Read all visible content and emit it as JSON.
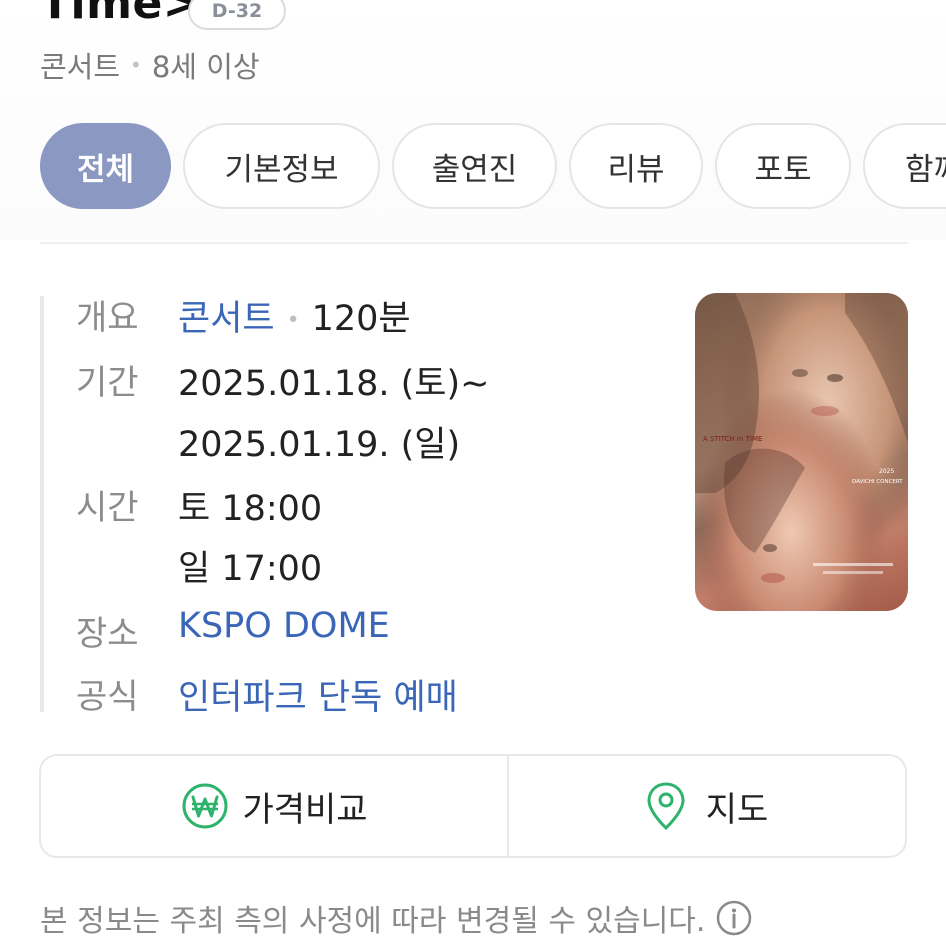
{
  "header": {
    "title": "Time>",
    "dday": "D-32",
    "category": "콘서트",
    "age": "8세 이상"
  },
  "tabs": [
    {
      "label": "전체",
      "active": true
    },
    {
      "label": "기본정보"
    },
    {
      "label": "출연진"
    },
    {
      "label": "리뷰"
    },
    {
      "label": "포토"
    },
    {
      "label": "함께"
    }
  ],
  "info": {
    "overview": {
      "label": "개요",
      "genre": "콘서트",
      "runtime": "120분"
    },
    "period": {
      "label": "기간",
      "start": "2025.01.18. (토)~",
      "end": "2025.01.19. (일)"
    },
    "time": {
      "label": "시간",
      "line1": "토 18:00",
      "line2": "일 17:00"
    },
    "venue": {
      "label": "장소",
      "value": "KSPO DOME"
    },
    "official": {
      "label": "공식",
      "value": "인터파크 단독 예매"
    }
  },
  "poster": {
    "text_1": "A STITCH in TIME",
    "text_2": "2025",
    "text_3": "DAVICHI CONCERT"
  },
  "actions": {
    "price_compare": "가격비교",
    "map": "지도"
  },
  "notice": "본 정보는 주최 측의 사정에 따라 변경될 수 있습니다.",
  "colors": {
    "accent": "#8a98c2",
    "link": "#3a66b7",
    "won_icon": "#2db36b",
    "map_icon": "#2db36b"
  },
  "icons": {
    "price": "won-circle-icon",
    "map": "map-pin-icon",
    "info": "info-circle-icon"
  }
}
